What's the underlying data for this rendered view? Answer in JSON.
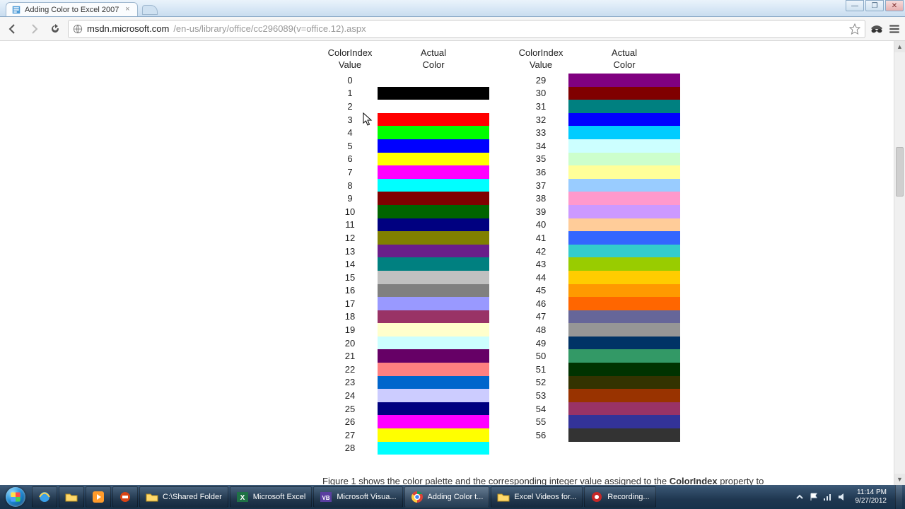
{
  "browser": {
    "tab_title": "Adding Color to Excel 2007",
    "url_host": "msdn.microsoft.com",
    "url_path": "/en-us/library/office/cc296089(v=office.12).aspx"
  },
  "headers": {
    "index": "ColorIndex Value",
    "color": "Actual Color"
  },
  "caption_prefix": "Figure 1 shows the color palette and the corresponding integer value assigned to the ",
  "caption_bold": "ColorIndex",
  "caption_suffix": " property to",
  "left_rows": [
    {
      "index": "0",
      "color": ""
    },
    {
      "index": "1",
      "color": "#000000"
    },
    {
      "index": "2",
      "color": "#FFFFFF"
    },
    {
      "index": "3",
      "color": "#FF0000"
    },
    {
      "index": "4",
      "color": "#00FF00"
    },
    {
      "index": "5",
      "color": "#0000FF"
    },
    {
      "index": "6",
      "color": "#FFFF00"
    },
    {
      "index": "7",
      "color": "#FF00FF"
    },
    {
      "index": "8",
      "color": "#00FFFF"
    },
    {
      "index": "9",
      "color": "#800000"
    },
    {
      "index": "10",
      "color": "#006400"
    },
    {
      "index": "11",
      "color": "#000080"
    },
    {
      "index": "12",
      "color": "#808000"
    },
    {
      "index": "13",
      "color": "#6A1E8A"
    },
    {
      "index": "14",
      "color": "#008080"
    },
    {
      "index": "15",
      "color": "#C0C0C0"
    },
    {
      "index": "16",
      "color": "#808080"
    },
    {
      "index": "17",
      "color": "#9999FF"
    },
    {
      "index": "18",
      "color": "#993366"
    },
    {
      "index": "19",
      "color": "#FFFFCC"
    },
    {
      "index": "20",
      "color": "#CCFFFF"
    },
    {
      "index": "21",
      "color": "#660066"
    },
    {
      "index": "22",
      "color": "#FF8080"
    },
    {
      "index": "23",
      "color": "#0066CC"
    },
    {
      "index": "24",
      "color": "#CCCCFF"
    },
    {
      "index": "25",
      "color": "#000080"
    },
    {
      "index": "26",
      "color": "#FF00FF"
    },
    {
      "index": "27",
      "color": "#FFFF00"
    },
    {
      "index": "28",
      "color": "#00FFFF"
    }
  ],
  "right_rows": [
    {
      "index": "29",
      "color": "#800080"
    },
    {
      "index": "30",
      "color": "#800000"
    },
    {
      "index": "31",
      "color": "#008080"
    },
    {
      "index": "32",
      "color": "#0000FF"
    },
    {
      "index": "33",
      "color": "#00CCFF"
    },
    {
      "index": "34",
      "color": "#CCFFFF"
    },
    {
      "index": "35",
      "color": "#CCFFCC"
    },
    {
      "index": "36",
      "color": "#FFFF99"
    },
    {
      "index": "37",
      "color": "#99CCFF"
    },
    {
      "index": "38",
      "color": "#FF99CC"
    },
    {
      "index": "39",
      "color": "#CC99FF"
    },
    {
      "index": "40",
      "color": "#FFCC99"
    },
    {
      "index": "41",
      "color": "#3366FF"
    },
    {
      "index": "42",
      "color": "#33CCCC"
    },
    {
      "index": "43",
      "color": "#99CC00"
    },
    {
      "index": "44",
      "color": "#FFCC00"
    },
    {
      "index": "45",
      "color": "#FF9900"
    },
    {
      "index": "46",
      "color": "#FF6600"
    },
    {
      "index": "47",
      "color": "#666699"
    },
    {
      "index": "48",
      "color": "#969696"
    },
    {
      "index": "49",
      "color": "#003366"
    },
    {
      "index": "50",
      "color": "#339966"
    },
    {
      "index": "51",
      "color": "#003300"
    },
    {
      "index": "52",
      "color": "#333300"
    },
    {
      "index": "53",
      "color": "#993300"
    },
    {
      "index": "54",
      "color": "#993366"
    },
    {
      "index": "55",
      "color": "#333399"
    },
    {
      "index": "56",
      "color": "#333333"
    }
  ],
  "taskbar": {
    "items": [
      {
        "label": "C:\\Shared Folder",
        "icon": "folder"
      },
      {
        "label": "Microsoft Excel",
        "icon": "excel"
      },
      {
        "label": "Microsoft Visua...",
        "icon": "vb"
      },
      {
        "label": "Adding Color t...",
        "icon": "chrome",
        "active": true
      },
      {
        "label": "Excel Videos for...",
        "icon": "folder2"
      },
      {
        "label": "Recording...",
        "icon": "rec"
      }
    ],
    "time": "11:14 PM",
    "date": "9/27/2012"
  }
}
